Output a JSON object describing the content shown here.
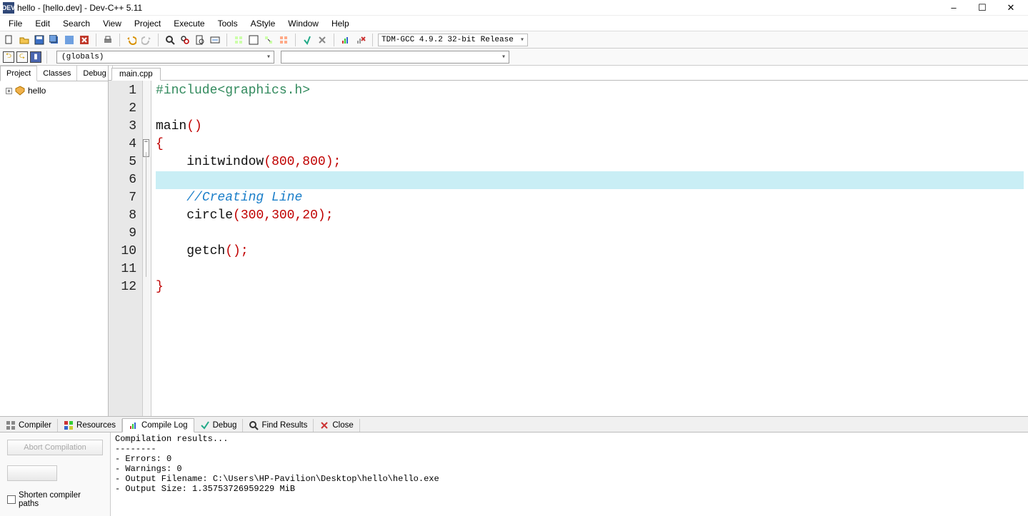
{
  "title": "hello - [hello.dev] - Dev-C++ 5.11",
  "menu": [
    "File",
    "Edit",
    "Search",
    "View",
    "Project",
    "Execute",
    "Tools",
    "AStyle",
    "Window",
    "Help"
  ],
  "compiler_selected": "TDM-GCC 4.9.2 32-bit Release",
  "scope_dd1": "(globals)",
  "scope_dd2": "",
  "side_tabs": [
    "Project",
    "Classes",
    "Debug"
  ],
  "side_tab_active": "Project",
  "project_tree": {
    "root": "hello"
  },
  "editor_tabs": [
    "main.cpp"
  ],
  "code_lines": [
    {
      "n": 1,
      "html": "<span class='kw-pre'>#include&lt;graphics.h&gt;</span>"
    },
    {
      "n": 2,
      "html": ""
    },
    {
      "n": 3,
      "html": "<span class='fn'>main</span><span class='paren'>()</span>"
    },
    {
      "n": 4,
      "html": "<span class='brace'>{</span>",
      "fold": true
    },
    {
      "n": 5,
      "html": "    <span class='fn'>initwindow</span><span class='paren'>(</span><span class='num'>800</span><span class='semi'>,</span><span class='num'>800</span><span class='paren'>)</span><span class='semi'>;</span>",
      "guide": true
    },
    {
      "n": 6,
      "html": "",
      "hl": true,
      "guide": true
    },
    {
      "n": 7,
      "html": "    <span class='cmt'>//Creating Line</span>",
      "guide": true
    },
    {
      "n": 8,
      "html": "    <span class='fn'>circle</span><span class='paren'>(</span><span class='num'>300</span><span class='semi'>,</span><span class='num'>300</span><span class='semi'>,</span><span class='num'>20</span><span class='paren'>)</span><span class='semi'>;</span>",
      "guide": true
    },
    {
      "n": 9,
      "html": "",
      "guide": true
    },
    {
      "n": 10,
      "html": "    <span class='fn'>getch</span><span class='paren'>()</span><span class='semi'>;</span>",
      "guide": true
    },
    {
      "n": 11,
      "html": "",
      "guide": true
    },
    {
      "n": 12,
      "html": "<span class='brace'>}</span>"
    }
  ],
  "bottom_tabs": [
    {
      "label": "Compiler",
      "icon": "grid"
    },
    {
      "label": "Resources",
      "icon": "grid-color"
    },
    {
      "label": "Compile Log",
      "icon": "chart",
      "active": true
    },
    {
      "label": "Debug",
      "icon": "check"
    },
    {
      "label": "Find Results",
      "icon": "search"
    },
    {
      "label": "Close",
      "icon": "x"
    }
  ],
  "bottom_left": {
    "abort": "Abort Compilation",
    "shorten": "Shorten compiler paths"
  },
  "output_lines": [
    "Compilation results...",
    "--------",
    "- Errors: 0",
    "- Warnings: 0",
    "- Output Filename: C:\\Users\\HP-Pavilion\\Desktop\\hello\\hello.exe",
    "- Output Size: 1.35753726959229 MiB"
  ]
}
